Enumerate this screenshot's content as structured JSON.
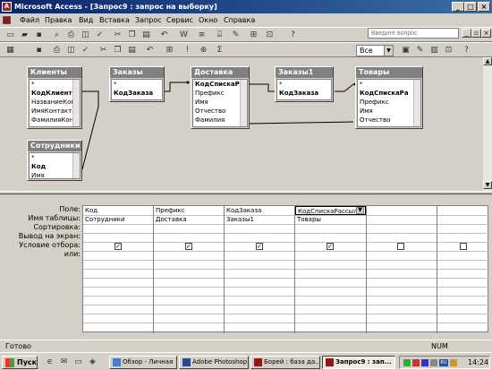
{
  "window": {
    "title": "Microsoft Access - [Запрос9 : запрос на выборку]"
  },
  "menu": [
    "Файл",
    "Правка",
    "Вид",
    "Вставка",
    "Запрос",
    "Сервис",
    "Окно",
    "Справка"
  ],
  "help_placeholder": "Введите вопрос",
  "toolbar2": {
    "combo_value": "Все"
  },
  "tables": [
    {
      "title": "Клиенты",
      "fields": [
        "*",
        "КодКлиента",
        "НазваниеКом",
        "ИмяКонтакта",
        "ФамилияКонт"
      ],
      "key": "КодКлиента"
    },
    {
      "title": "Заказы",
      "fields": [
        "*",
        "КодЗаказа"
      ],
      "key": "КодЗаказа"
    },
    {
      "title": "Доставка",
      "fields": [
        "КодСпискаРа",
        "Префикс",
        "Имя",
        "Отчество",
        "Фамилия"
      ],
      "key": "КодСпискаРа"
    },
    {
      "title": "Заказы1",
      "fields": [
        "*",
        "КодЗаказа"
      ],
      "key": "КодЗаказа"
    },
    {
      "title": "Товары",
      "fields": [
        "*",
        "КодСпискаРа",
        "Префикс",
        "Имя",
        "Отчество"
      ],
      "key": "КодСпискаРа"
    },
    {
      "title": "Сотрудники",
      "fields": [
        "*",
        "Код",
        "Имя"
      ],
      "key": "Код"
    }
  ],
  "grid": {
    "row_labels": [
      "Поле:",
      "Имя таблицы:",
      "Сортировка:",
      "Вывод на экран:",
      "Условие отбора:",
      "или:"
    ],
    "fields": [
      "Код",
      "Префикс",
      "КодЗаказа",
      "КодСпискаРассыл",
      ""
    ],
    "tables": [
      "Сотрудники",
      "Доставка",
      "Заказы1",
      "Товары",
      ""
    ],
    "show": [
      true,
      true,
      true,
      true,
      false,
      false
    ]
  },
  "status": {
    "left": "Готово",
    "right": "NUM"
  },
  "taskbar": {
    "start": "Пуск",
    "tasks": [
      "Обзор - Личная",
      "Adobe Photoshop",
      "Борей : база да...",
      "Запрос9 : зап..."
    ],
    "clock": "14:24"
  }
}
